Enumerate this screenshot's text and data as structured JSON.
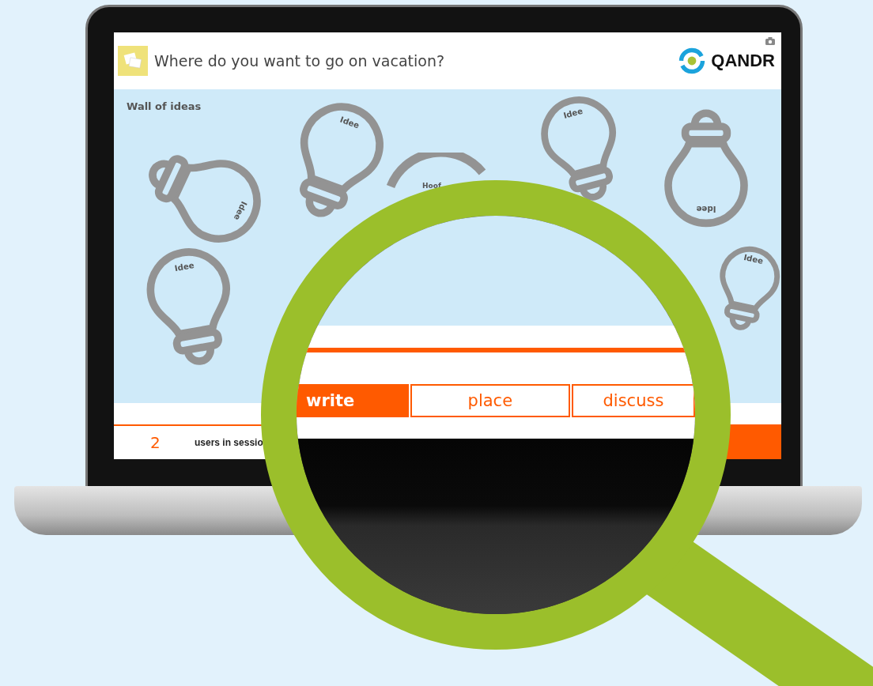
{
  "header": {
    "title": "Where do you want to go on vacation?",
    "logo": "QANDR"
  },
  "wall": {
    "title": "Wall of ideas",
    "bulbs": [
      {
        "label": "Idee"
      },
      {
        "label": "Idee"
      },
      {
        "label": "Hoof"
      },
      {
        "label": "Idee"
      },
      {
        "label": "Idee"
      },
      {
        "label": "Idee"
      },
      {
        "label": "Idee"
      }
    ]
  },
  "footer": {
    "count": "2",
    "text": "users in sessio"
  },
  "magnified": {
    "tabs": [
      {
        "label": "write",
        "selected": true
      },
      {
        "label": "place",
        "selected": false
      },
      {
        "label": "discuss",
        "selected": false
      }
    ]
  }
}
